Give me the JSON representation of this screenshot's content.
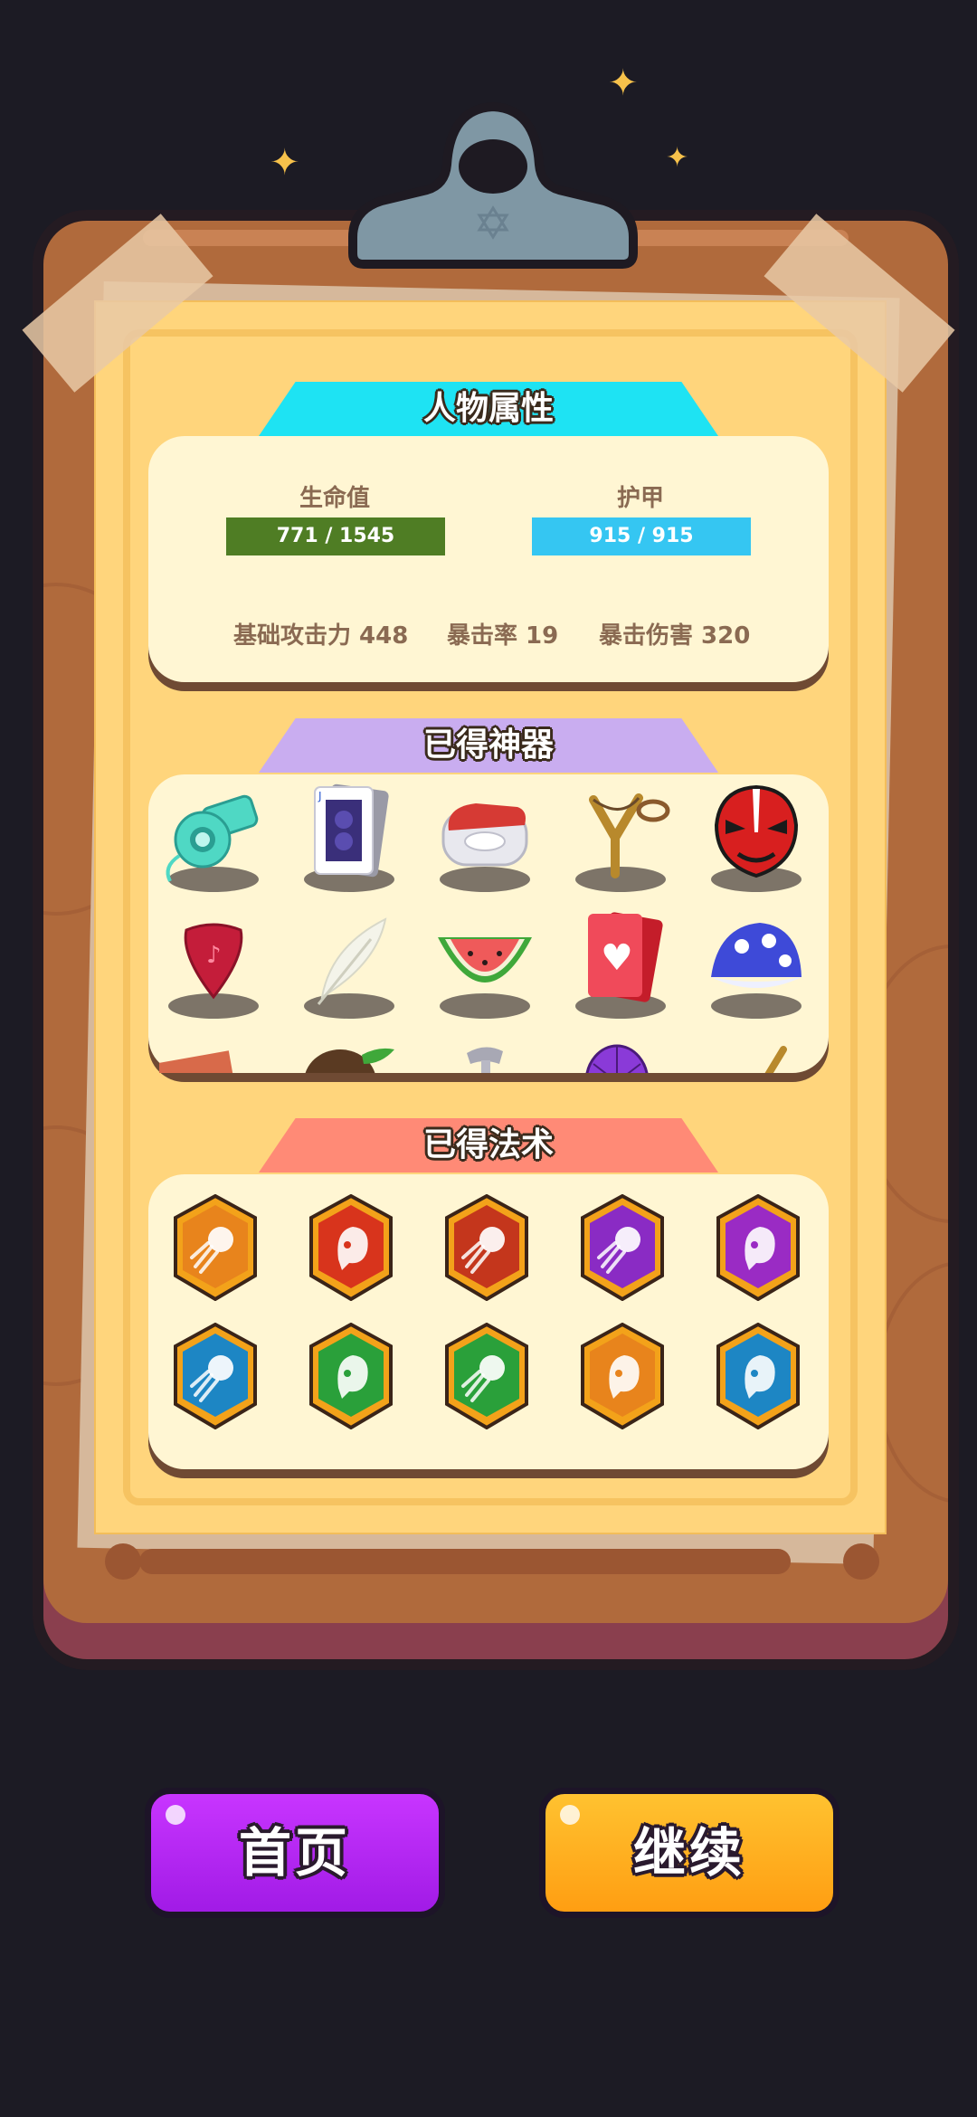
{
  "stats": {
    "title": "人物属性",
    "hp_label": "生命值",
    "hp_text": "771 / 1545",
    "hp_fraction": 0.5,
    "armor_label": "护甲",
    "armor_text": "915 / 915",
    "armor_fraction": 1.0,
    "attack": "基础攻击力 448",
    "crit_rate": "暴击率 19",
    "crit_damage": "暴击伤害 320"
  },
  "artifacts": {
    "title": "已得神器",
    "items": [
      "whistle-icon",
      "playing-card-icon",
      "earbuds-icon",
      "slingshot-icon",
      "opera-mask-icon",
      "guitar-pick-icon",
      "feather-icon",
      "watermelon-icon",
      "heart-cards-icon",
      "blue-shell-icon",
      "ruler-icon",
      "coconut-icon",
      "hammer-icon",
      "net-icon",
      "stick-icon"
    ]
  },
  "spells": {
    "title": "已得法术",
    "items": [
      {
        "icon": "fireball-icon",
        "color": "#e8841c"
      },
      {
        "icon": "ghost-icon",
        "color": "#d8341c"
      },
      {
        "icon": "fireball-icon",
        "color": "#c4361c"
      },
      {
        "icon": "fireball-icon",
        "color": "#8a2bc4"
      },
      {
        "icon": "ghost-icon",
        "color": "#9a2bc4"
      },
      {
        "icon": "fireball-icon",
        "color": "#1d86c4"
      },
      {
        "icon": "ghost-icon",
        "color": "#2aa03a"
      },
      {
        "icon": "fireball-icon",
        "color": "#2aa03a"
      },
      {
        "icon": "ghost-icon",
        "color": "#e8841c"
      },
      {
        "icon": "ghost-icon",
        "color": "#1d86c4"
      }
    ]
  },
  "buttons": {
    "home_label": "首页",
    "continue_label": "继续"
  },
  "colors": {
    "hp_bar": "#4f7d24",
    "armor_bar": "#35c6f2",
    "stats_header": "#1ee3f3",
    "artifacts_header": "#c9adf0",
    "spells_header": "#ff8a76",
    "home_button": "#b21df0",
    "continue_button": "#ffac1c"
  }
}
